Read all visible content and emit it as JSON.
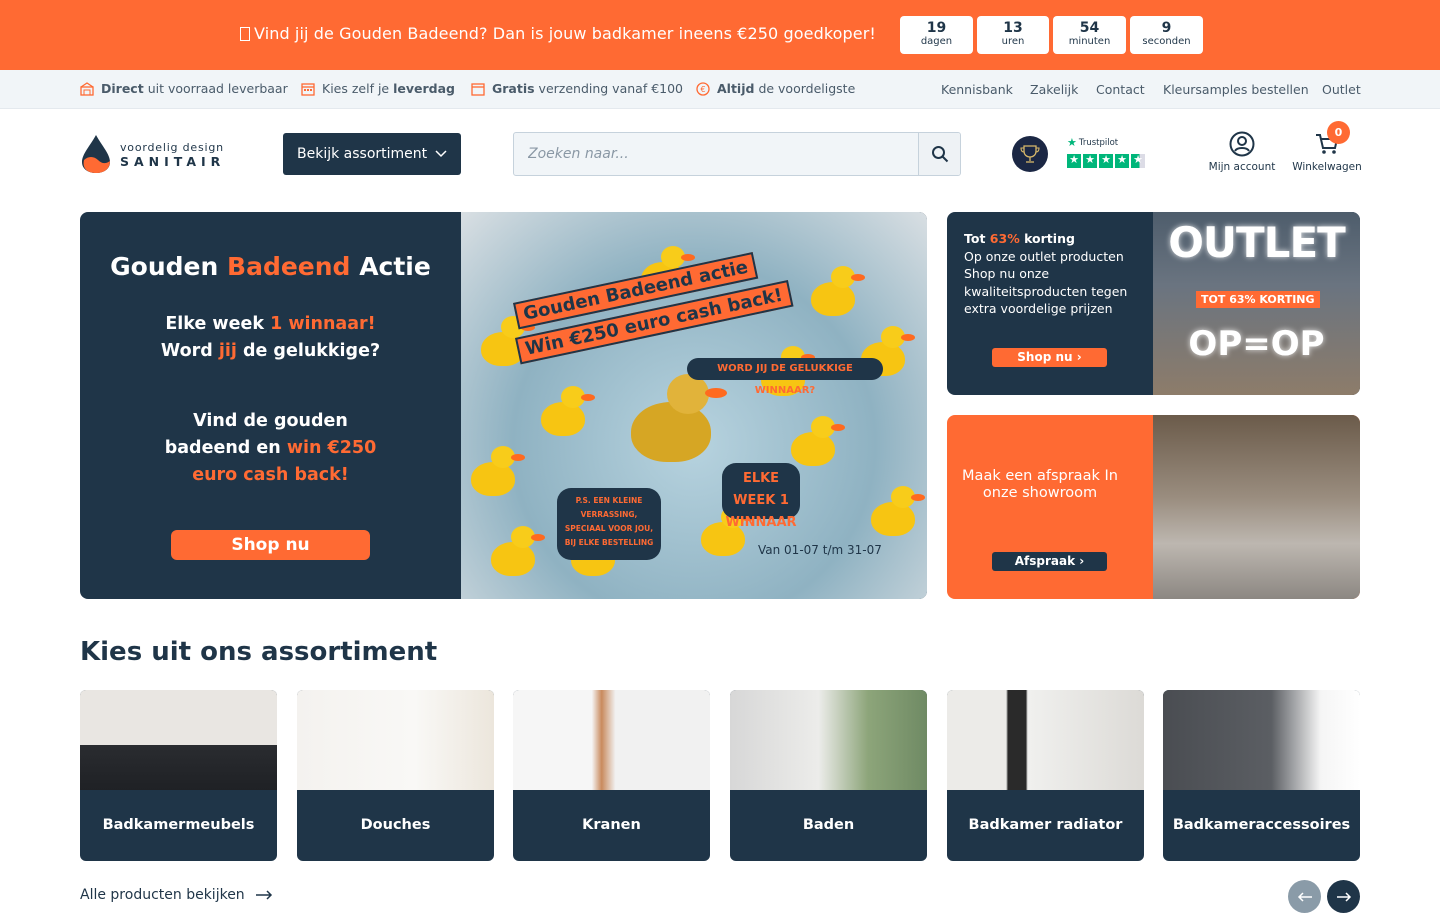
{
  "promo": {
    "text": "Vind jij de Gouden Badeend? Dan is jouw badkamer ineens €250 goedkoper!",
    "countdown": [
      {
        "value": "19",
        "label": "dagen"
      },
      {
        "value": "13",
        "label": "uren"
      },
      {
        "value": "54",
        "label": "minuten"
      },
      {
        "value": "9",
        "label": "seconden"
      }
    ]
  },
  "usps": [
    {
      "bold": "Direct",
      "rest": "uit voorraad leverbaar",
      "icon": "warehouse-icon"
    },
    {
      "pre": "Kies zelf je",
      "bold": "leverdag",
      "icon": "calendar-icon"
    },
    {
      "bold": "Gratis",
      "rest": "verzending vanaf €100",
      "icon": "delivery-calendar-icon"
    },
    {
      "bold": "Altijd",
      "rest": "de voordeligste",
      "icon": "euro-icon"
    }
  ],
  "topnav": [
    "Kennisbank",
    "Zakelijk",
    "Contact",
    "Kleursamples bestellen",
    "Outlet"
  ],
  "header": {
    "logo_sub": "voordelig design",
    "logo_main": "SANITAIR",
    "assort_button": "Bekijk assortiment",
    "search_placeholder": "Zoeken naar...",
    "trustpilot": "Trustpilot",
    "account": "Mijn account",
    "cart": "Winkelwagen",
    "cart_count": "0"
  },
  "hero": {
    "title_a": "Gouden",
    "title_b": "Badeend",
    "title_c": "Actie",
    "line1_a": "Elke week",
    "line1_b": "1 winnaar!",
    "line2_a": "Word",
    "line2_b": "jij",
    "line2_c": "de gelukkige?",
    "line3": "Vind de gouden",
    "line4_a": "badeend en",
    "line4_b": "win €250",
    "line5": "euro cash back!",
    "shop": "Shop nu",
    "strip1": "Gouden Badeend actie",
    "strip2": "Win €250 euro cash back!",
    "bubble_lucky": "WORD JIJ DE GELUKKIGE WINNAAR?",
    "bubble_week": "ELKE WEEK 1 WINNAAR",
    "bubble_ps": "P.S. EEN KLEINE VERRASSING, SPECIAAL VOOR JOU, BIJ ELKE BESTELLING",
    "date": "Van 01-07 t/m 31-07"
  },
  "outlet": {
    "tot": "Tot",
    "pct": "63%",
    "korting": "korting",
    "body": "Op onze outlet producten Shop nu onze kwaliteitsproducten tegen extra voordelige prijzen",
    "shop": "Shop nu",
    "word": "OUTLET",
    "tag": "TOT 63% KORTING",
    "op": "OP=OP"
  },
  "showroom": {
    "text": "Maak een afspraak In onze showroom",
    "button": "Afspraak"
  },
  "assortment": {
    "title": "Kies uit ons assortiment",
    "categories": [
      "Badkamermeubels",
      "Douches",
      "Kranen",
      "Baden",
      "Badkamer radiator",
      "Badkameraccessoires"
    ],
    "all_link": "Alle producten bekijken"
  },
  "colors": {
    "accent": "#ff6a33",
    "navy": "#1f3548",
    "trustpilot_green": "#00b67a"
  }
}
